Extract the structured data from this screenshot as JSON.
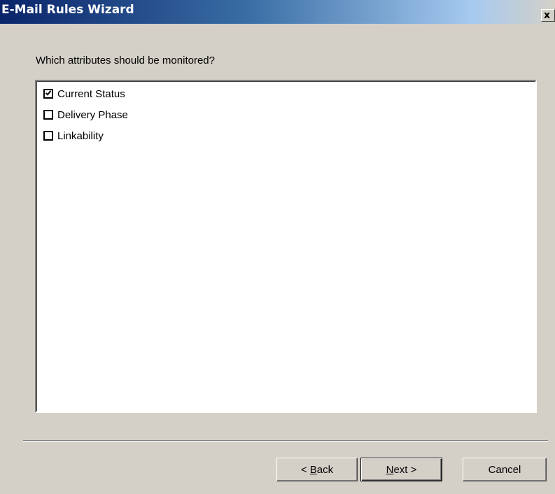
{
  "window": {
    "title": "E-Mail Rules Wizard",
    "close_glyph": "x"
  },
  "question": "Which attributes should be monitored?",
  "attributes": [
    {
      "label": "Current Status",
      "checked": true
    },
    {
      "label": "Delivery Phase",
      "checked": false
    },
    {
      "label": "Linkability",
      "checked": false
    }
  ],
  "buttons": {
    "back": {
      "prefix": "< ",
      "mnemonic": "B",
      "rest": "ack"
    },
    "next": {
      "prefix": "",
      "mnemonic": "N",
      "rest": "ext >"
    },
    "cancel": {
      "label": "Cancel"
    }
  },
  "icons": {
    "close": "close-icon",
    "check": "checkmark-icon"
  },
  "colors": {
    "title_bar_start": "#0a246a",
    "dialog_face": "#d4d0c8",
    "list_background": "#ffffff"
  }
}
